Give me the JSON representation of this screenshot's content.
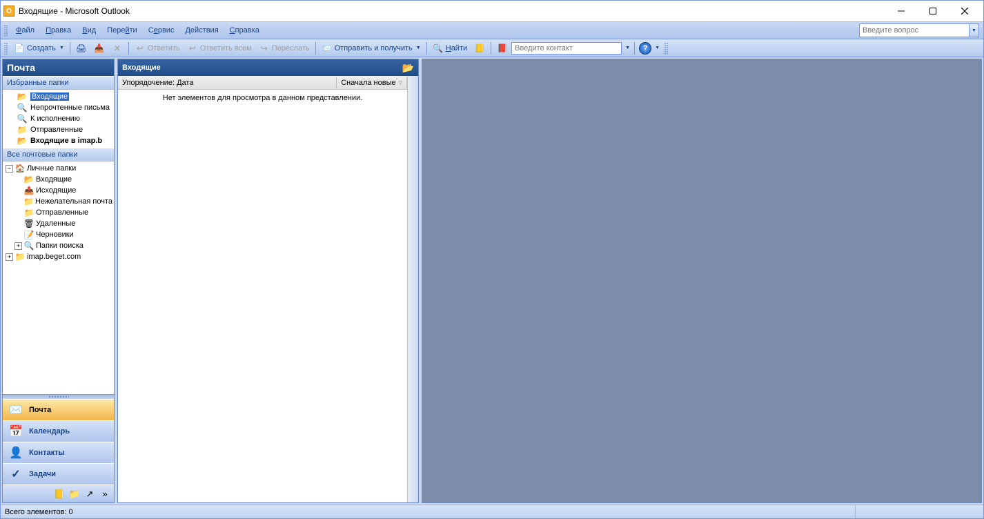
{
  "window": {
    "title": "Входящие - Microsoft Outlook"
  },
  "menubar": {
    "items": [
      "Файл",
      "Правка",
      "Вид",
      "Перейти",
      "Сервис",
      "Действия",
      "Справка"
    ],
    "ask_placeholder": "Введите вопрос"
  },
  "toolbar": {
    "create": "Создать",
    "reply": "Ответить",
    "reply_all": "Ответить всем",
    "forward": "Переслать",
    "send_receive": "Отправить и получить",
    "find": "Найти",
    "contact_placeholder": "Введите контакт"
  },
  "nav": {
    "header": "Почта",
    "fav_header": "Избранные папки",
    "fav": [
      {
        "name": "Входящие",
        "selected": true
      },
      {
        "name": "Непрочтенные письма"
      },
      {
        "name": "К исполнению"
      },
      {
        "name": "Отправленные"
      },
      {
        "name": "Входящие в imap.b",
        "bold": true
      }
    ],
    "all_header": "Все почтовые папки",
    "tree_root": "Личные папки",
    "tree": [
      "Входящие",
      "Исходящие",
      "Нежелательная почта",
      "Отправленные",
      "Удаленные",
      "Черновики"
    ],
    "tree_search": "Папки поиска",
    "tree_imap": "imap.beget.com",
    "buttons": {
      "mail": "Почта",
      "calendar": "Календарь",
      "contacts": "Контакты",
      "tasks": "Задачи"
    }
  },
  "list": {
    "header": "Входящие",
    "sort_label": "Упорядочение: Дата",
    "sort_dir": "Сначала новые",
    "empty": "Нет элементов для просмотра в данном представлении."
  },
  "status": {
    "text": "Всего элементов: 0"
  }
}
